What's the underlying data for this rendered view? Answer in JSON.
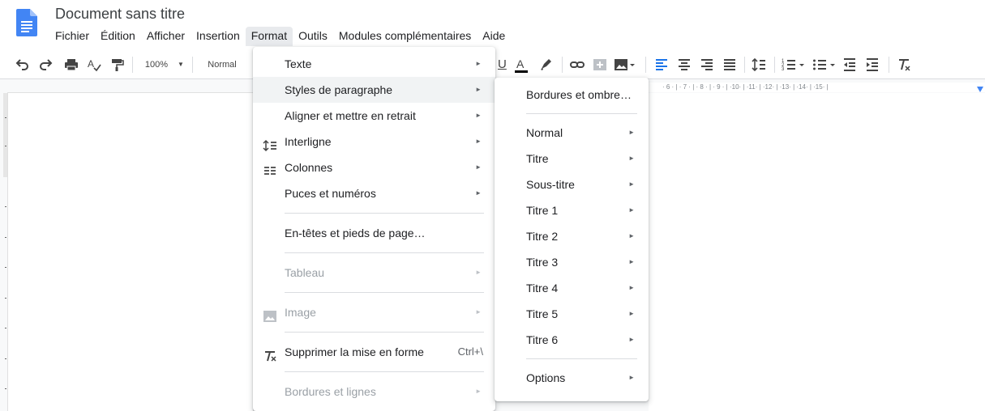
{
  "app": {
    "title": "Document sans titre",
    "logo_icon": "google-docs-icon"
  },
  "menubar": [
    "Fichier",
    "Édition",
    "Afficher",
    "Insertion",
    "Format",
    "Outils",
    "Modules complémentaires",
    "Aide"
  ],
  "toolbar": {
    "zoom": "100%",
    "style": "Normal",
    "icons": [
      "undo-icon",
      "redo-icon",
      "print-icon",
      "spellcheck-icon",
      "paint-format-icon",
      "underline-icon",
      "text-color-icon",
      "highlight-icon",
      "link-icon",
      "comment-icon",
      "image-icon",
      "align-left-icon",
      "align-center-icon",
      "align-right-icon",
      "justify-icon",
      "line-spacing-icon",
      "numbered-list-icon",
      "bulleted-list-icon",
      "decrease-indent-icon",
      "increase-indent-icon",
      "clear-formatting-icon"
    ],
    "underline_letter": "U",
    "text_color_letter": "A"
  },
  "ruler": {
    "text": "· 6 · | · 7 · | · 8 · | · 9 · | ·10· | ·11· | ·12· | ·13· | ·14· | ·15· |"
  },
  "format_menu": {
    "items": [
      {
        "label": "Texte"
      },
      {
        "label": "Styles de paragraphe"
      },
      {
        "label": "Aligner et mettre en retrait"
      },
      {
        "label": "Interligne"
      },
      {
        "label": "Colonnes"
      },
      {
        "label": "Puces et numéros"
      },
      {
        "label": "En-têtes et pieds de page…"
      },
      {
        "label": "Tableau"
      },
      {
        "label": "Image"
      },
      {
        "label": "Supprimer la mise en forme",
        "shortcut": "Ctrl+\\"
      },
      {
        "label": "Bordures et lignes"
      }
    ]
  },
  "styles_submenu": {
    "items": [
      {
        "label": "Bordures et ombre…"
      },
      {
        "label": "Normal"
      },
      {
        "label": "Titre"
      },
      {
        "label": "Sous-titre"
      },
      {
        "label": "Titre 1"
      },
      {
        "label": "Titre 2"
      },
      {
        "label": "Titre 3"
      },
      {
        "label": "Titre 4"
      },
      {
        "label": "Titre 5"
      },
      {
        "label": "Titre 6"
      },
      {
        "label": "Options"
      }
    ]
  },
  "colors": {
    "accent": "#1a73e8",
    "menu_highlight": "#f1f3f4",
    "disabled_text": "#9aa0a6"
  }
}
